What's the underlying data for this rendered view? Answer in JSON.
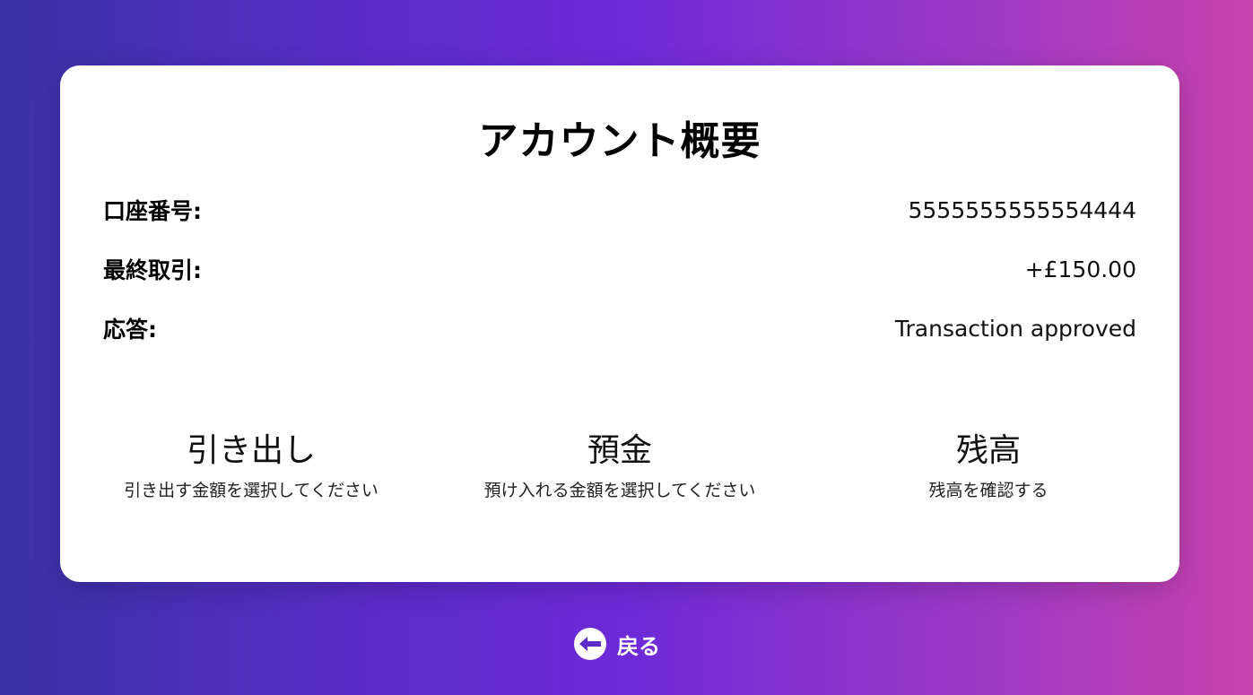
{
  "card": {
    "title": "アカウント概要",
    "rows": [
      {
        "label": "口座番号:",
        "value": "5555555555554444"
      },
      {
        "label": "最終取引:",
        "value": "+£150.00"
      },
      {
        "label": "応答:",
        "value": "Transaction approved"
      }
    ],
    "actions": [
      {
        "title": "引き出し",
        "subtitle": "引き出す金額を選択してください"
      },
      {
        "title": "預金",
        "subtitle": "預け入れる金額を選択してください"
      },
      {
        "title": "残高",
        "subtitle": "残高を確認する"
      }
    ]
  },
  "nav": {
    "back_label": "戻る",
    "back_icon": "arrow-left-icon"
  },
  "colors": {
    "gradient_start": "#3a32a6",
    "gradient_mid": "#6d2ad8",
    "gradient_end": "#c842ac",
    "card_background": "#ffffff"
  }
}
